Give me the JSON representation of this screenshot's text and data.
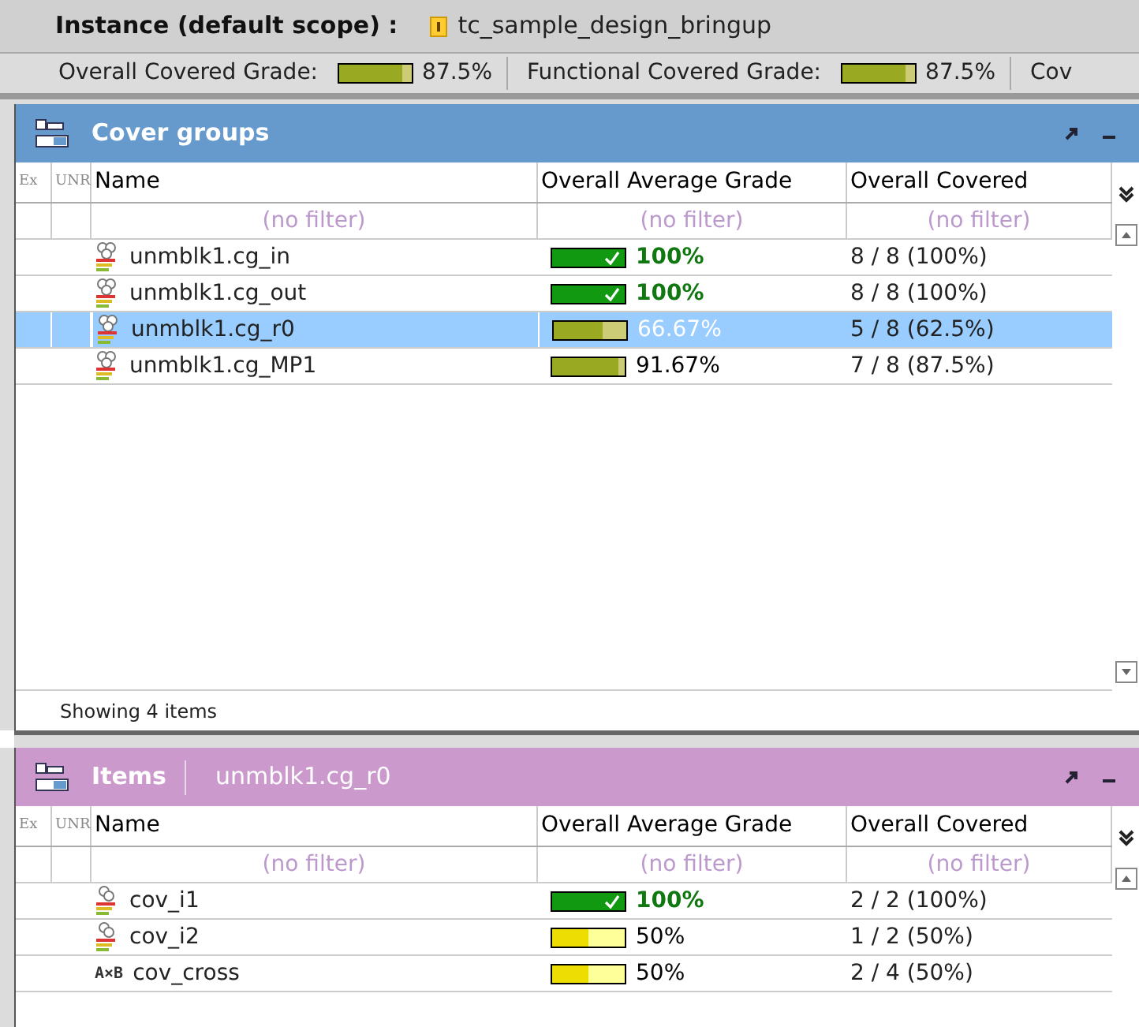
{
  "instance": {
    "label": "Instance (default scope) :",
    "name": "tc_sample_design_bringup"
  },
  "summary": [
    {
      "label": "Overall Covered Grade:",
      "level": 0.875,
      "kind": "olive",
      "value": "87.5%"
    },
    {
      "label": "Functional Covered Grade:",
      "level": 0.875,
      "kind": "olive",
      "value": "87.5%"
    },
    {
      "label": "Cov"
    }
  ],
  "cover_groups": {
    "title": "Cover groups",
    "columns": [
      "Ex",
      "UNR",
      "Name",
      "Overall Average Grade",
      "Overall Covered"
    ],
    "filters": [
      "(no filter)",
      "(no filter)",
      "(no filter)"
    ],
    "rows": [
      {
        "name": "unmblk1.cg_in",
        "kind": "group",
        "grade": {
          "level": 1,
          "kind": "full",
          "value": "100%"
        },
        "covered": "8 / 8 (100%)",
        "selected": false
      },
      {
        "name": "unmblk1.cg_out",
        "kind": "group",
        "grade": {
          "level": 1,
          "kind": "full",
          "value": "100%"
        },
        "covered": "8 / 8 (100%)",
        "selected": false
      },
      {
        "name": "unmblk1.cg_r0",
        "kind": "group",
        "grade": {
          "level": 0.6667,
          "kind": "olive",
          "value": "66.67%"
        },
        "covered": "5 / 8 (62.5%)",
        "selected": true
      },
      {
        "name": "unmblk1.cg_MP1",
        "kind": "group",
        "grade": {
          "level": 0.9167,
          "kind": "olive",
          "value": "91.67%"
        },
        "covered": "7 / 8 (87.5%)",
        "selected": false
      }
    ],
    "footer": "Showing 4 items"
  },
  "items": {
    "title": "Items",
    "context": "unmblk1.cg_r0",
    "columns": [
      "Ex",
      "UNR",
      "Name",
      "Overall Average Grade",
      "Overall Covered"
    ],
    "filters": [
      "(no filter)",
      "(no filter)",
      "(no filter)"
    ],
    "rows": [
      {
        "name": "cov_i1",
        "kind": "item",
        "grade": {
          "level": 1,
          "kind": "full",
          "value": "100%"
        },
        "covered": "2 / 2 (100%)",
        "selected": false
      },
      {
        "name": "cov_i2",
        "kind": "item",
        "grade": {
          "level": 0.5,
          "kind": "yellow",
          "value": "50%"
        },
        "covered": "1 / 2 (50%)",
        "selected": false
      },
      {
        "name": "cov_cross",
        "kind": "cross",
        "icon_text": "A×B",
        "grade": {
          "level": 0.5,
          "kind": "yellow",
          "value": "50%"
        },
        "covered": "2 / 4 (50%)",
        "selected": false
      }
    ]
  }
}
